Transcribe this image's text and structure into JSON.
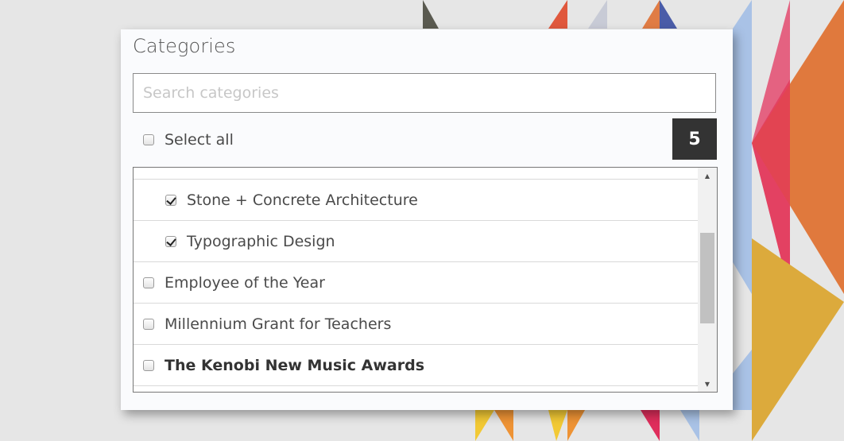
{
  "panel": {
    "title": "Categories",
    "search": {
      "placeholder": "Search categories",
      "value": ""
    },
    "select_all": {
      "label": "Select all",
      "checked": false
    },
    "selected_count": "5",
    "list": {
      "items": [
        {
          "label": "Stone + Concrete Architecture",
          "checked": true,
          "indented": true,
          "bold": false
        },
        {
          "label": "Typographic Design",
          "checked": true,
          "indented": true,
          "bold": false
        },
        {
          "label": "Employee of the Year",
          "checked": false,
          "indented": false,
          "bold": false
        },
        {
          "label": "Millennium Grant for Teachers",
          "checked": false,
          "indented": false,
          "bold": false
        },
        {
          "label": "The Kenobi New Music Awards",
          "checked": false,
          "indented": false,
          "bold": true
        }
      ],
      "scroll_up_icon": "triangle-up",
      "scroll_down_icon": "triangle-down"
    }
  },
  "colors": {
    "page_background": "#e6e6e6",
    "panel_background": "#fafbfd",
    "badge_background": "#333333",
    "badge_text": "#ffffff"
  }
}
